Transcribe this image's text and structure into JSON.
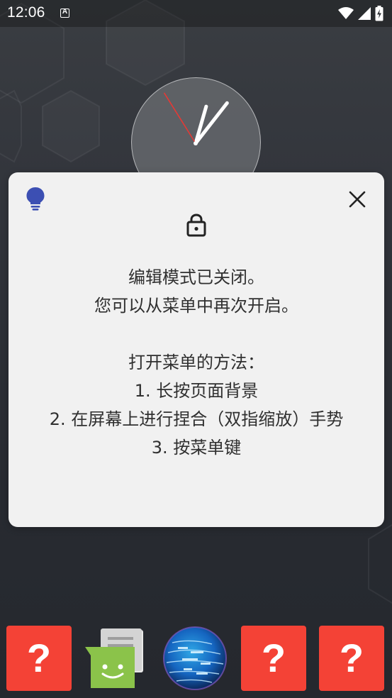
{
  "status_bar": {
    "time": "12:06",
    "notification_icon": "a-box-icon",
    "wifi_icon": "wifi-icon",
    "signal_icon": "signal-icon",
    "battery_icon": "battery-charging-icon"
  },
  "clock": {
    "hour_hand_angle_deg": 16,
    "minute_hand_angle_deg": 38,
    "second_hand_angle_deg": -32
  },
  "dialog": {
    "tip_icon": "lightbulb-icon",
    "close_icon": "close-icon",
    "lock_icon": "lock-icon",
    "line1": "编辑模式已关闭。",
    "line2": "您可以从菜单中再次开启。",
    "line3": "打开菜单的方法：",
    "line4": "1. 长按页面背景",
    "line5": "2. 在屏幕上进行捏合（双指缩放）手势",
    "line6": "3. 按菜单键",
    "accent_color": "#3c4fb3"
  },
  "dock": {
    "apps": [
      {
        "icon": "unknown-app-icon",
        "glyph": "?"
      },
      {
        "icon": "messaging-app-icon"
      },
      {
        "icon": "browser-globe-icon"
      },
      {
        "icon": "unknown-app-icon",
        "glyph": "?"
      },
      {
        "icon": "unknown-app-icon",
        "glyph": "?"
      }
    ]
  }
}
